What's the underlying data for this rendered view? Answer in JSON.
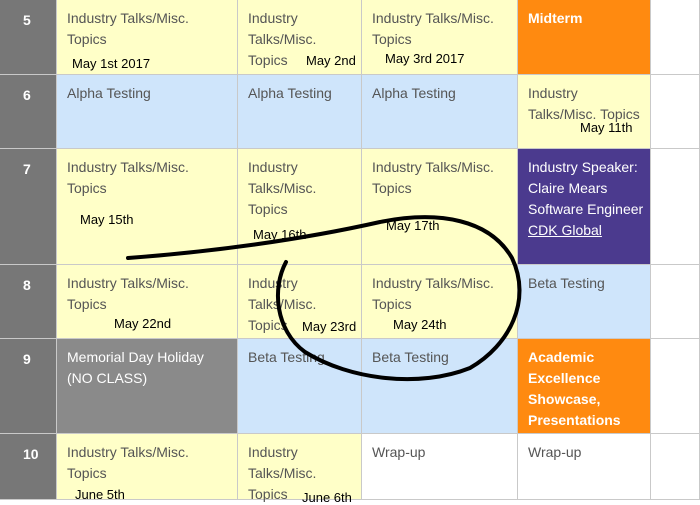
{
  "rows": [
    {
      "week": "5",
      "c1": {
        "text": "Industry Talks/Misc. Topics",
        "date": "May 1st 2017"
      },
      "c2": {
        "text": "Industry Talks/Misc. Topics",
        "date": "May 2nd"
      },
      "c3": {
        "text": "Industry Talks/Misc. Topics",
        "date": "May 3rd 2017"
      },
      "c4": {
        "text": "Midterm"
      }
    },
    {
      "week": "6",
      "c1": {
        "text": "Alpha Testing"
      },
      "c2": {
        "text": "Alpha Testing"
      },
      "c3": {
        "text": "Alpha Testing"
      },
      "c4": {
        "text": "Industry Talks/Misc. Topics",
        "date": "May 11th"
      }
    },
    {
      "week": "7",
      "c1": {
        "text": "Industry Talks/Misc. Topics",
        "date": "May 15th"
      },
      "c2": {
        "text": "Industry Talks/Misc. Topics",
        "date": "May 16th"
      },
      "c3": {
        "text": "Industry Talks/Misc. Topics",
        "date": "May 17th"
      },
      "c4": {
        "text": "Industry Speaker: Claire Mears Software Engineer",
        "link": "CDK Global"
      }
    },
    {
      "week": "8",
      "c1": {
        "text": "Industry Talks/Misc. Topics",
        "date": "May 22nd"
      },
      "c2": {
        "text": "Industry Talks/Misc. Topics",
        "date": "May 23rd"
      },
      "c3": {
        "text": "Industry Talks/Misc. Topics",
        "date": "May 24th"
      },
      "c4": {
        "text": "Beta Testing"
      }
    },
    {
      "week": "9",
      "c1": {
        "text": "Memorial Day Holiday (NO CLASS)"
      },
      "c2": {
        "text": "Beta Testing"
      },
      "c3": {
        "text": "Beta Testing"
      },
      "c4": {
        "text": "Academic Excellence Showcase, Presentations"
      }
    },
    {
      "week": "10",
      "c1": {
        "text": "Industry Talks/Misc. Topics",
        "date": "June 5th"
      },
      "c2": {
        "text": "Industry Talks/Misc. Topics",
        "date": "June 6th"
      },
      "c3": {
        "text": "Wrap-up"
      },
      "c4": {
        "text": "Wrap-up"
      }
    }
  ],
  "colors": {
    "week_bg": "#777777",
    "topic_bg": "#ffffc8",
    "testing_bg": "#cfe5fb",
    "holiday_bg": "#8a8a8a",
    "highlight_bg": "#ff8a10",
    "speaker_bg": "#4b3a8e"
  }
}
